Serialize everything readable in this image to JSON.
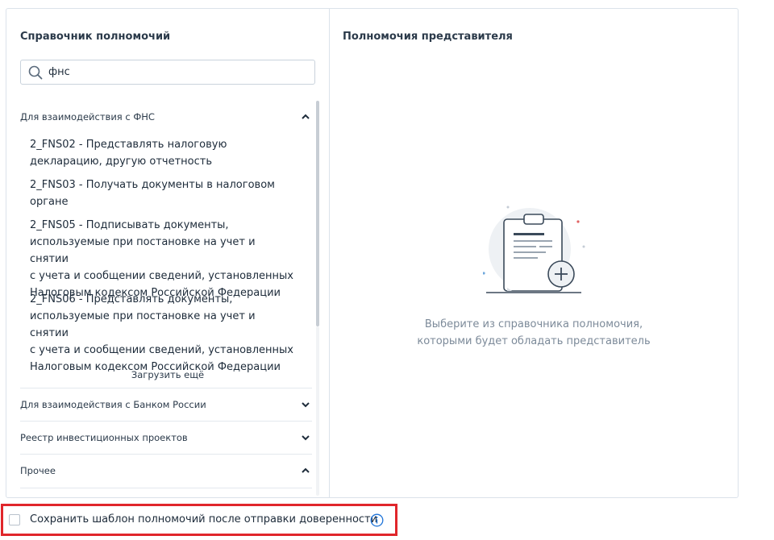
{
  "left_panel": {
    "title": "Справочник полномочий",
    "search": {
      "value": "фнс",
      "placeholder": ""
    },
    "groups": [
      {
        "label": "Для взаимодействия с ФНС",
        "expanded": true
      },
      {
        "label": "Для взаимодействия с Банком России",
        "expanded": false
      },
      {
        "label": "Реестр инвестиционных проектов",
        "expanded": false
      },
      {
        "label": "Прочее",
        "expanded": true
      }
    ],
    "items": [
      {
        "lines": [
          "2_FNS02 - Представлять налоговую",
          "декларацию, другую отчетность"
        ]
      },
      {
        "lines": [
          "2_FNS03 - Получать документы в налоговом",
          "органе"
        ]
      },
      {
        "lines": [
          "2_FNS05 - Подписывать документы,",
          "используемые при постановке на учет и снятии",
          "с учета и сообщении сведений, установленных",
          "Налоговым кодексом Российской Федерации"
        ]
      },
      {
        "lines": [
          "2_FNS06 - Представлять документы,",
          "используемые при постановке на учет и снятии",
          "с учета и сообщении сведений, установленных",
          "Налоговым кодексом Российской Федерации"
        ]
      }
    ],
    "load_more": "Загрузить ещё"
  },
  "right_panel": {
    "title": "Полномочия представителя",
    "empty_lines": [
      "Выберите из справочника полномочия,",
      "которыми будет обладать представитель"
    ]
  },
  "footer": {
    "checkbox_label": "Сохранить шаблон полномочий после отправки доверенности",
    "checked": false
  },
  "colors": {
    "accent": "#1e73d8",
    "highlight_border": "#e0262b",
    "muted_text": "#7c8a99"
  }
}
